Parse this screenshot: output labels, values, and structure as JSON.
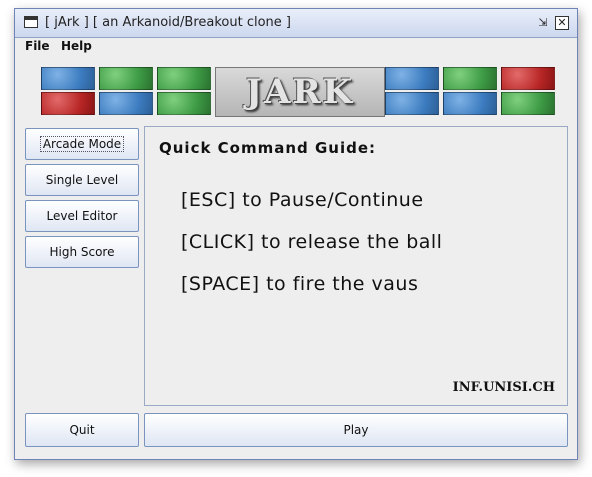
{
  "window": {
    "title": "[ jArk ] [ an Arkanoid/Breakout clone ]",
    "restore_glyph": "⇲",
    "close_glyph": "✕"
  },
  "menu": {
    "file": "File",
    "help": "Help"
  },
  "banner": {
    "logo_text": "JARK",
    "brick_colors": {
      "blue": "#3c7cc0",
      "green": "#3e9b45",
      "red": "#b82626"
    }
  },
  "sidebar": {
    "arcade": "Arcade Mode",
    "single": "Single Level",
    "editor": "Level Editor",
    "highscore": "High Score"
  },
  "guide": {
    "title": "Quick Command Guide:",
    "line1": "[ESC] to Pause/Continue",
    "line2": "[CLICK] to release the ball",
    "line3": "[SPACE] to fire the vaus",
    "brand": "INF.UNISI.CH"
  },
  "bottom": {
    "quit": "Quit",
    "play": "Play"
  }
}
